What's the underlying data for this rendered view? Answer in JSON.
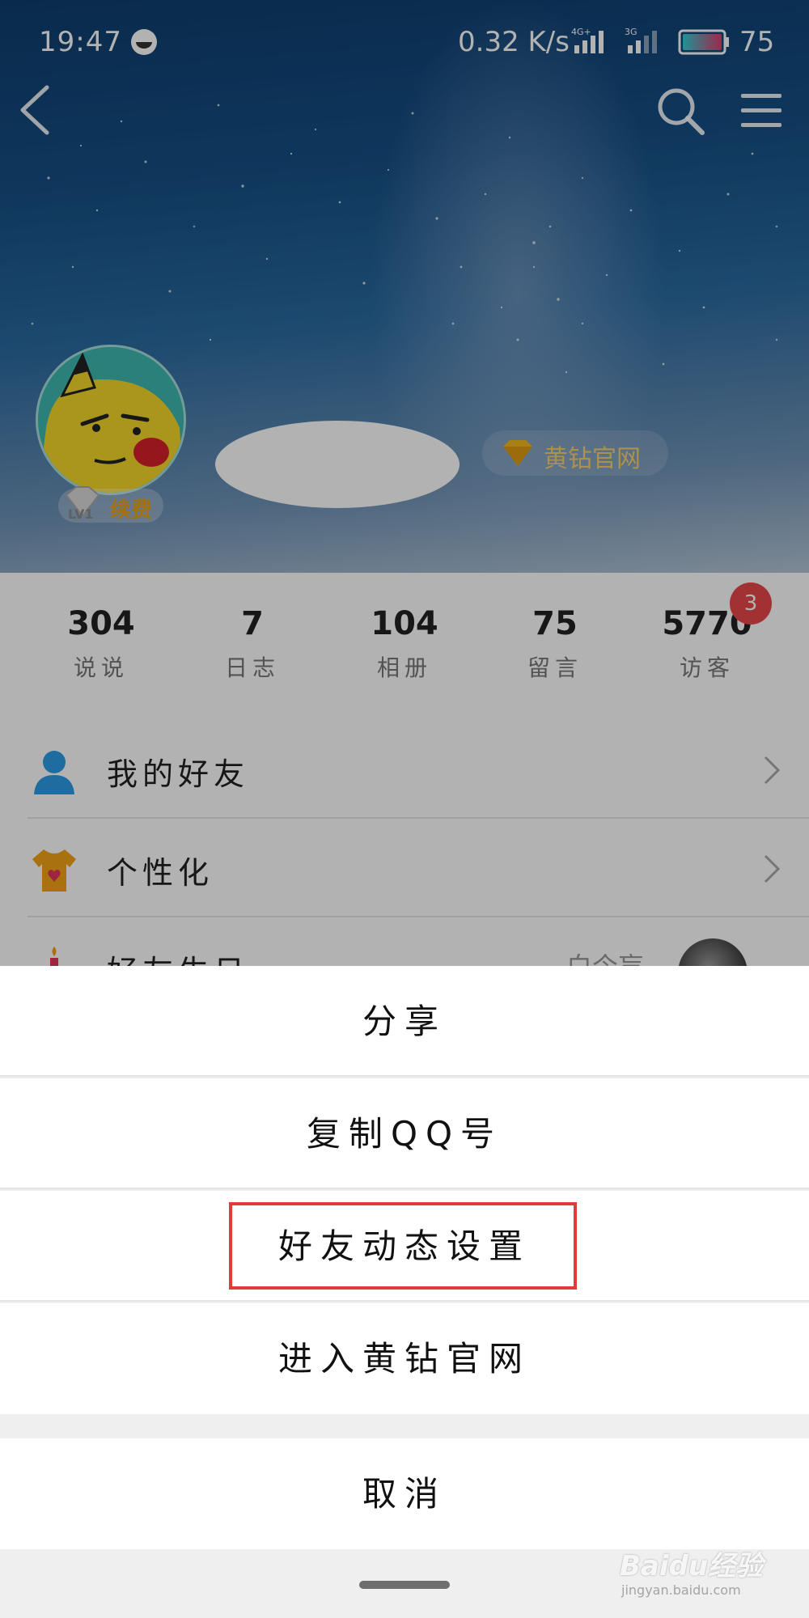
{
  "status_bar": {
    "time": "19:47",
    "speed": "0.32 K/s",
    "network1": "4G+",
    "network2": "3G",
    "battery": "75"
  },
  "profile": {
    "level": "LV1",
    "renew_label": "续费",
    "vip_link": "黄钻官网"
  },
  "stats": [
    {
      "value": "304",
      "label": "说说"
    },
    {
      "value": "7",
      "label": "日志"
    },
    {
      "value": "104",
      "label": "相册"
    },
    {
      "value": "75",
      "label": "留言"
    },
    {
      "value": "5770",
      "label": "访客",
      "badge": "3"
    }
  ],
  "menu": {
    "items": [
      {
        "label": "我的好友",
        "icon": "friends-icon"
      },
      {
        "label": "个性化",
        "icon": "tshirt-icon"
      },
      {
        "label": "好友生日",
        "icon": "candle-icon",
        "extra": "白今盲"
      }
    ]
  },
  "action_sheet": {
    "options": [
      "分享",
      "复制QQ号",
      "好友动态设置",
      "进入黄钻官网"
    ],
    "cancel": "取消",
    "highlighted_option": "好友动态设置",
    "highlight_color": "#e23b3b"
  },
  "watermark": {
    "brand": "Baidu经验",
    "url": "jingyan.baidu.com"
  }
}
